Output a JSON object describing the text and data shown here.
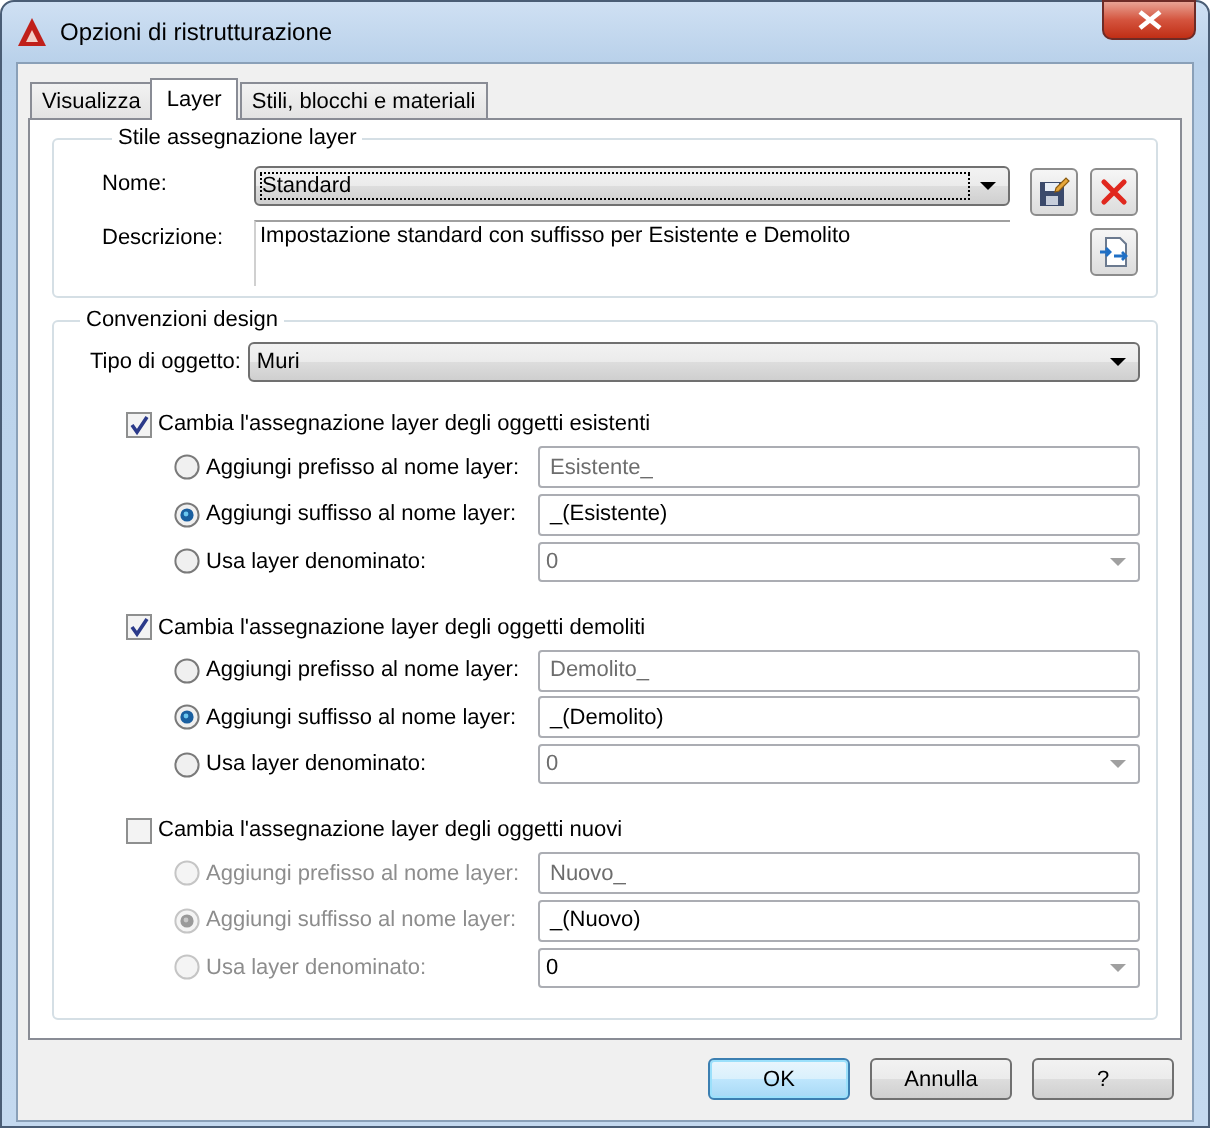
{
  "window": {
    "title": "Opzioni di ristrutturazione"
  },
  "tabs": [
    {
      "label": "Visualizza",
      "selected": false
    },
    {
      "label": "Layer",
      "selected": true
    },
    {
      "label": "Stili, blocchi e materiali",
      "selected": false
    }
  ],
  "layer_style": {
    "title": "Stile assegnazione layer",
    "name_label": "Nome:",
    "name_value": "Standard",
    "description_label": "Descrizione:",
    "description": "Impostazione standard con suffisso per Esistente e Demolito"
  },
  "design_conventions": {
    "title": "Convenzioni design",
    "object_type_label": "Tipo di oggetto:",
    "object_type": "Muri",
    "groups": [
      {
        "label": "Cambia l'assegnazione layer degli oggetti esistenti",
        "checked": true,
        "options": [
          {
            "label": "Aggiungi prefisso al nome layer:",
            "selected": false,
            "kind": "text",
            "value": "Esistente_"
          },
          {
            "label": "Aggiungi suffisso al nome layer:",
            "selected": true,
            "kind": "text",
            "value": "_(Esistente)"
          },
          {
            "label": "Usa layer denominato:",
            "selected": false,
            "kind": "combo",
            "value": "0"
          }
        ]
      },
      {
        "label": "Cambia l'assegnazione layer degli oggetti demoliti",
        "checked": true,
        "options": [
          {
            "label": "Aggiungi prefisso al nome layer:",
            "selected": false,
            "kind": "text",
            "value": "Demolito_"
          },
          {
            "label": "Aggiungi suffisso al nome layer:",
            "selected": true,
            "kind": "text",
            "value": "_(Demolito)"
          },
          {
            "label": "Usa layer denominato:",
            "selected": false,
            "kind": "combo",
            "value": "0"
          }
        ]
      },
      {
        "label": "Cambia l'assegnazione layer degli oggetti nuovi",
        "checked": false,
        "options": [
          {
            "label": "Aggiungi prefisso al nome layer:",
            "selected": false,
            "kind": "text",
            "value": "Nuovo_"
          },
          {
            "label": "Aggiungi suffisso al nome layer:",
            "selected": true,
            "kind": "text",
            "value": "_(Nuovo)"
          },
          {
            "label": "Usa layer denominato:",
            "selected": false,
            "kind": "combo",
            "value": "0"
          }
        ]
      }
    ]
  },
  "buttons": [
    {
      "label": "OK",
      "default": true
    },
    {
      "label": "Annulla",
      "default": false
    },
    {
      "label": "?",
      "default": false
    }
  ]
}
